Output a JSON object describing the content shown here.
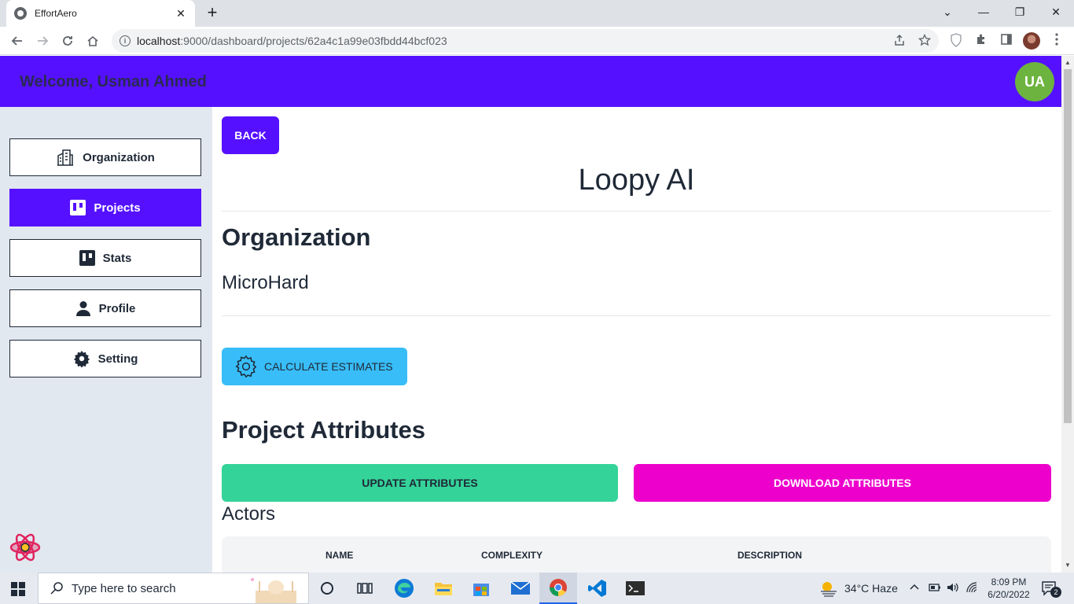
{
  "browser": {
    "tab_title": "EffortAero",
    "tab_close": "✕",
    "new_tab": "+",
    "window_controls": [
      "⌄",
      "—",
      "❐",
      "✕"
    ],
    "url_host": "localhost",
    "url_path": ":9000/dashboard/projects/62a4c1a99e03fbdd44bcf023"
  },
  "header": {
    "welcome": "Welcome, Usman Ahmed",
    "avatar_initials": "UA"
  },
  "sidebar": {
    "items": [
      {
        "label": "Organization",
        "icon": "building-icon",
        "active": false
      },
      {
        "label": "Projects",
        "icon": "trello-board-icon",
        "active": true
      },
      {
        "label": "Stats",
        "icon": "trello-board-icon",
        "active": false
      },
      {
        "label": "Profile",
        "icon": "user-icon",
        "active": false
      },
      {
        "label": "Setting",
        "icon": "gear-icon",
        "active": false
      }
    ]
  },
  "main": {
    "back_label": "BACK",
    "project_title": "Loopy AI",
    "organization_heading": "Organization",
    "organization_name": "MicroHard",
    "calculate_label": "CALCULATE ESTIMATES",
    "attributes_heading": "Project Attributes",
    "update_label": "UPDATE ATTRIBUTES",
    "download_label": "DOWNLOAD ATTRIBUTES",
    "actors_heading": "Actors",
    "table_headers": [
      "NAME",
      "COMPLEXITY",
      "DESCRIPTION"
    ]
  },
  "taskbar": {
    "search_placeholder": "Type here to search",
    "weather": "34°C  Haze",
    "time": "8:09 PM",
    "date": "6/20/2022",
    "notifications": "2"
  },
  "colors": {
    "primary": "#5511ff",
    "avatar": "#6db33f",
    "calculate": "#38bdf8",
    "update": "#34d399",
    "download": "#ee00cc"
  }
}
